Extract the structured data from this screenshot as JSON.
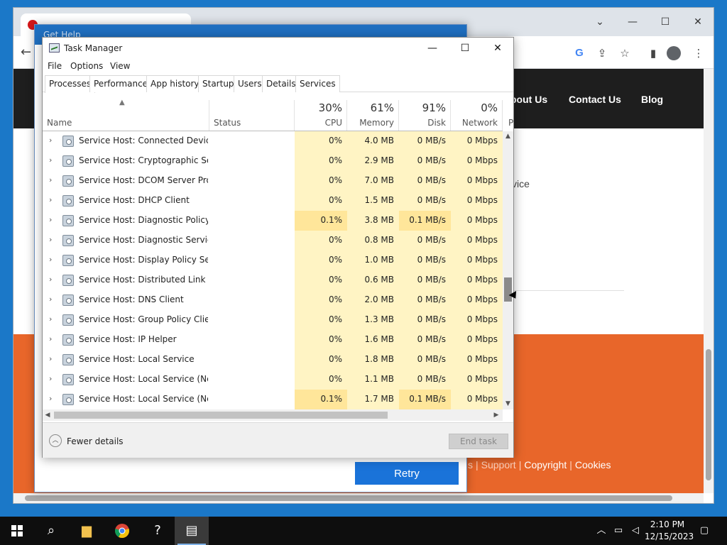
{
  "browser": {
    "nav": {
      "about": "bout Us",
      "contact": "Contact Us",
      "blog": "Blog"
    },
    "body_text": "vice",
    "footer": {
      "left_part": "s",
      "support": "Support",
      "copyright": "Copyright",
      "cookies": "Cookies"
    },
    "icons": [
      "google-icon",
      "share-icon",
      "star-icon",
      "sidebar-icon",
      "profile-icon",
      "menu-icon"
    ]
  },
  "gethelp": {
    "title": "Get Help",
    "retry_label": "Retry"
  },
  "taskmanager": {
    "title": "Task Manager",
    "menu": [
      "File",
      "Options",
      "View"
    ],
    "tabs": [
      "Processes",
      "Performance",
      "App history",
      "Startup",
      "Users",
      "Details",
      "Services"
    ],
    "active_tab": "Processes",
    "columns": {
      "name": "Name",
      "status": "Status",
      "cpu": {
        "pct": "30%",
        "label": "CPU"
      },
      "memory": {
        "pct": "61%",
        "label": "Memory"
      },
      "disk": {
        "pct": "91%",
        "label": "Disk"
      },
      "network": {
        "pct": "0%",
        "label": "Network"
      },
      "power_partial": "P"
    },
    "rows": [
      {
        "name": "Service Host: Connected Device...",
        "cpu": "0%",
        "mem": "4.0 MB",
        "disk": "0 MB/s",
        "net": "0 Mbps"
      },
      {
        "name": "Service Host: Cryptographic Ser...",
        "cpu": "0%",
        "mem": "2.9 MB",
        "disk": "0 MB/s",
        "net": "0 Mbps"
      },
      {
        "name": "Service Host: DCOM Server Proc...",
        "cpu": "0%",
        "mem": "7.0 MB",
        "disk": "0 MB/s",
        "net": "0 Mbps"
      },
      {
        "name": "Service Host: DHCP Client",
        "cpu": "0%",
        "mem": "1.5 MB",
        "disk": "0 MB/s",
        "net": "0 Mbps"
      },
      {
        "name": "Service Host: Diagnostic Policy ...",
        "cpu": "0.1%",
        "mem": "3.8 MB",
        "disk": "0.1 MB/s",
        "net": "0 Mbps",
        "highlight": true
      },
      {
        "name": "Service Host: Diagnostic Service...",
        "cpu": "0%",
        "mem": "0.8 MB",
        "disk": "0 MB/s",
        "net": "0 Mbps"
      },
      {
        "name": "Service Host: Display Policy Serv...",
        "cpu": "0%",
        "mem": "1.0 MB",
        "disk": "0 MB/s",
        "net": "0 Mbps"
      },
      {
        "name": "Service Host: Distributed Link Tr...",
        "cpu": "0%",
        "mem": "0.6 MB",
        "disk": "0 MB/s",
        "net": "0 Mbps"
      },
      {
        "name": "Service Host: DNS Client",
        "cpu": "0%",
        "mem": "2.0 MB",
        "disk": "0 MB/s",
        "net": "0 Mbps"
      },
      {
        "name": "Service Host: Group Policy Client",
        "cpu": "0%",
        "mem": "1.3 MB",
        "disk": "0 MB/s",
        "net": "0 Mbps"
      },
      {
        "name": "Service Host: IP Helper",
        "cpu": "0%",
        "mem": "1.6 MB",
        "disk": "0 MB/s",
        "net": "0 Mbps"
      },
      {
        "name": "Service Host: Local Service",
        "cpu": "0%",
        "mem": "1.8 MB",
        "disk": "0 MB/s",
        "net": "0 Mbps"
      },
      {
        "name": "Service Host: Local Service (Net...",
        "cpu": "0%",
        "mem": "1.1 MB",
        "disk": "0 MB/s",
        "net": "0 Mbps"
      },
      {
        "name": "Service Host: Local Service (Net...",
        "cpu": "0.1%",
        "mem": "1.7 MB",
        "disk": "0.1 MB/s",
        "net": "0 Mbps",
        "highlight": true
      }
    ],
    "fewer_details": "Fewer details",
    "end_task": "End task"
  },
  "taskbar": {
    "time": "2:10 PM",
    "date": "12/15/2023",
    "icons": [
      "start-icon",
      "search-icon",
      "file-explorer-icon",
      "chrome-icon",
      "get-help-icon",
      "task-manager-icon"
    ]
  },
  "colors": {
    "accent": "#1a73d9",
    "footer_orange": "#e8662a",
    "heat_light": "#fff4c4",
    "heat_mid": "#ffe69a"
  }
}
